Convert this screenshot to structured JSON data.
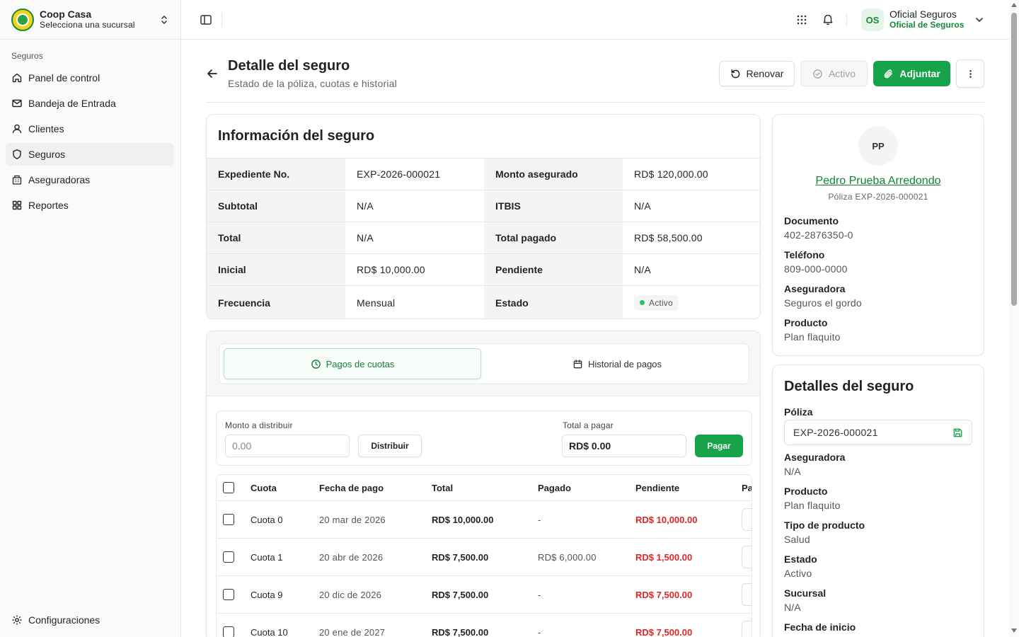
{
  "org": {
    "name": "Coop Casa",
    "subtitle": "Selecciona una sucursal"
  },
  "sidebar": {
    "group_label": "Seguros",
    "items": [
      {
        "label": "Panel de control",
        "icon": "home-icon"
      },
      {
        "label": "Bandeja de Entrada",
        "icon": "mail-icon"
      },
      {
        "label": "Clientes",
        "icon": "user-icon"
      },
      {
        "label": "Seguros",
        "icon": "shield-icon",
        "active": true
      },
      {
        "label": "Aseguradoras",
        "icon": "building-icon"
      },
      {
        "label": "Reportes",
        "icon": "grid-icon"
      }
    ],
    "bottom": {
      "label": "Configuraciones",
      "icon": "gear-icon"
    }
  },
  "user": {
    "initials": "OS",
    "name": "Oficial Seguros",
    "role": "Oficial de Seguros"
  },
  "header": {
    "title": "Detalle del seguro",
    "subtitle": "Estado de la póliza, cuotas e historial",
    "renew_label": "Renovar",
    "status_label": "Activo",
    "attach_label": "Adjuntar"
  },
  "info": {
    "title": "Información del seguro",
    "rows": [
      {
        "l1": "Expediente No.",
        "v1": "EXP-2026-000021",
        "l2": "Monto asegurado",
        "v2": "RD$ 120,000.00"
      },
      {
        "l1": "Subtotal",
        "v1": "N/A",
        "l2": "ITBIS",
        "v2": "N/A"
      },
      {
        "l1": "Total",
        "v1": "N/A",
        "l2": "Total pagado",
        "v2": "RD$ 58,500.00"
      },
      {
        "l1": "Inicial",
        "v1": "RD$ 10,000.00",
        "l2": "Pendiente",
        "v2": "N/A"
      },
      {
        "l1": "Frecuencia",
        "v1": "Mensual",
        "l2": "Estado",
        "v2": "Activo"
      }
    ]
  },
  "tabs": {
    "payments": "Pagos de cuotas",
    "history": "Historial de pagos"
  },
  "distribute": {
    "amount_label": "Monto a distribuir",
    "amount_placeholder": "0.00",
    "distribute_button": "Distribuir",
    "total_label": "Total a pagar",
    "total_value": "RD$ 0.00",
    "pay_button": "Pagar"
  },
  "table": {
    "headers": {
      "cuota": "Cuota",
      "fecha": "Fecha de pago",
      "total": "Total",
      "pagado": "Pagado",
      "pendiente": "Pendiente",
      "extra": "Pa"
    },
    "rows": [
      {
        "cuota": "Cuota 0",
        "fecha": "20 mar de 2026",
        "total": "RD$ 10,000.00",
        "pagado": "-",
        "pendiente": "RD$ 10,000.00"
      },
      {
        "cuota": "Cuota 1",
        "fecha": "20 abr de 2026",
        "total": "RD$ 7,500.00",
        "pagado": "RD$ 6,000.00",
        "pendiente": "RD$ 1,500.00"
      },
      {
        "cuota": "Cuota 9",
        "fecha": "20 dic de 2026",
        "total": "RD$ 7,500.00",
        "pagado": "-",
        "pendiente": "RD$ 7,500.00"
      },
      {
        "cuota": "Cuota 10",
        "fecha": "20 ene de 2027",
        "total": "RD$ 7,500.00",
        "pagado": "-",
        "pendiente": "RD$ 7,500.00"
      }
    ]
  },
  "client": {
    "initials": "PP",
    "name": "Pedro Prueba Arredondo",
    "policy": "Póliza EXP-2026-000021",
    "fields": [
      {
        "label": "Documento",
        "value": "402-2876350-0"
      },
      {
        "label": "Teléfono",
        "value": "809-000-0000"
      },
      {
        "label": "Aseguradora",
        "value": "Seguros el gordo"
      },
      {
        "label": "Producto",
        "value": "Plan flaquito"
      }
    ]
  },
  "details": {
    "title": "Detalles del seguro",
    "policy_label": "Póliza",
    "policy_value": "EXP-2026-000021",
    "fields": [
      {
        "label": "Aseguradora",
        "value": "N/A"
      },
      {
        "label": "Producto",
        "value": "Plan flaquito"
      },
      {
        "label": "Tipo de producto",
        "value": "Salud"
      },
      {
        "label": "Estado",
        "value": "Activo"
      },
      {
        "label": "Sucursal",
        "value": "N/A"
      },
      {
        "label": "Fecha de inicio",
        "value": ""
      }
    ]
  },
  "colors": {
    "accent": "#16a34a",
    "danger": "#dc2626",
    "active_dot": "#22c55e"
  }
}
